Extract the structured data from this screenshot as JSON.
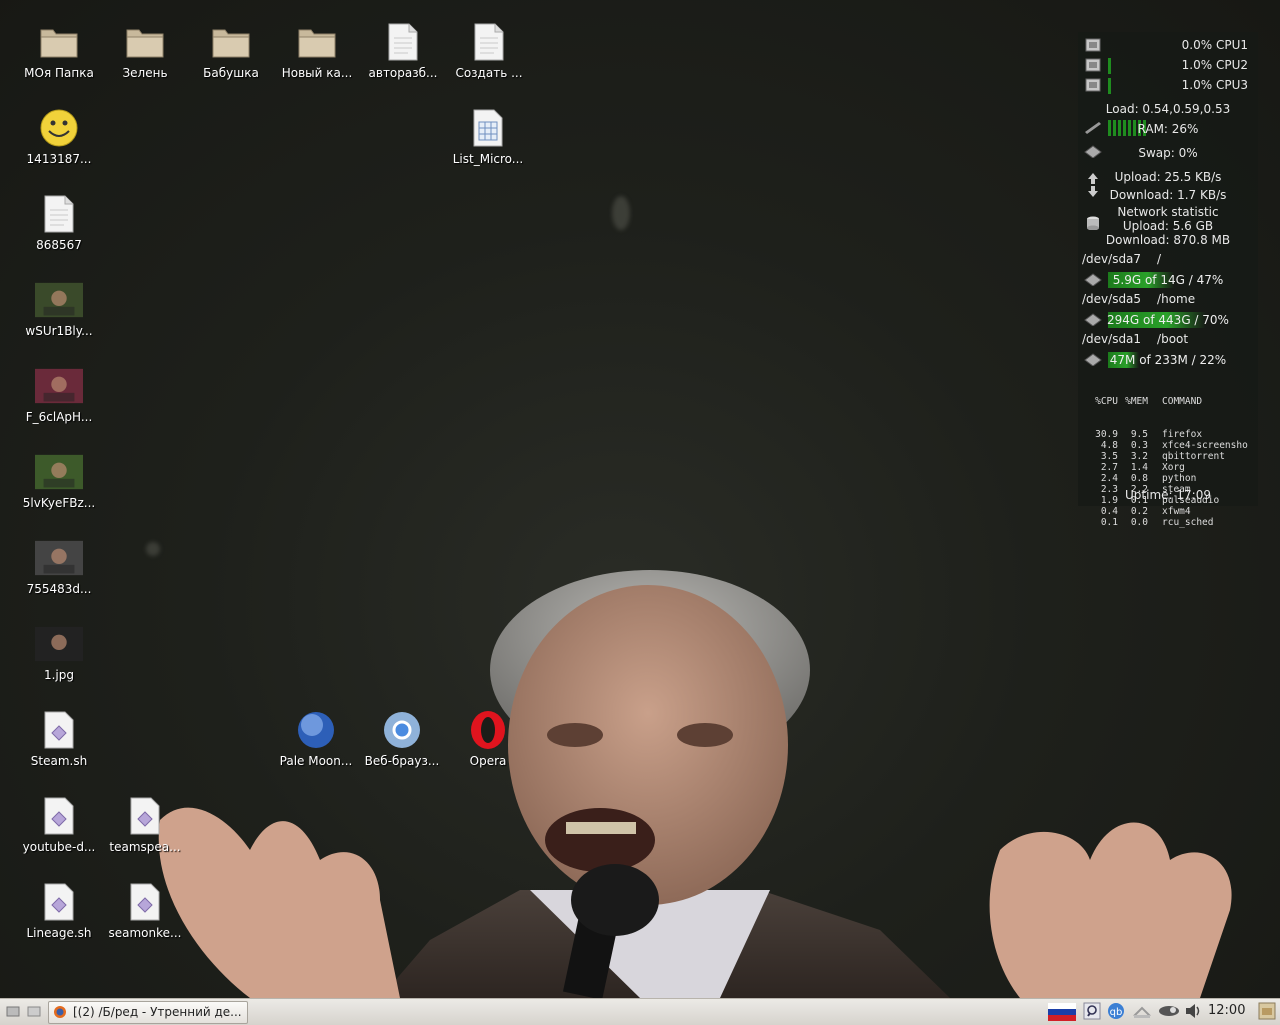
{
  "desktop": {
    "icons_row1": [
      {
        "label": "МОя Папка",
        "icon": "folder-icon"
      },
      {
        "label": "Зелень",
        "icon": "folder-icon"
      },
      {
        "label": "Бабушка",
        "icon": "folder-icon"
      },
      {
        "label": "Новый ка...",
        "icon": "folder-icon"
      },
      {
        "label": "авторазб...",
        "icon": "text-file-icon"
      },
      {
        "label": "Создать ...",
        "icon": "text-file-icon"
      }
    ],
    "list_micro": {
      "label": "List_Micro...",
      "icon": "spreadsheet-file-icon"
    },
    "column1": [
      {
        "label": "1413187...",
        "icon": "smiley-image-icon"
      },
      {
        "label": "868567",
        "icon": "text-file-icon"
      },
      {
        "label": "wSUr1Bly...",
        "icon": "image-thumbnail-icon"
      },
      {
        "label": "F_6clApH...",
        "icon": "image-thumbnail-icon"
      },
      {
        "label": "5lvKyeFBz...",
        "icon": "image-thumbnail-icon"
      },
      {
        "label": "755483d...",
        "icon": "image-thumbnail-icon"
      },
      {
        "label": "1.jpg",
        "icon": "image-thumbnail-icon"
      },
      {
        "label": "Steam.sh",
        "icon": "script-file-icon"
      },
      {
        "label": "youtube-d...",
        "icon": "script-file-icon"
      },
      {
        "label": "Lineage.sh",
        "icon": "script-file-icon"
      }
    ],
    "column2": [
      {
        "label": "teamspea...",
        "icon": "script-file-icon"
      },
      {
        "label": "seamonke...",
        "icon": "script-file-icon"
      }
    ],
    "browsers": [
      {
        "label": "Pale Moon...",
        "icon": "pale-moon-icon"
      },
      {
        "label": "Веб-брауз...",
        "icon": "chromium-icon"
      },
      {
        "label": "Opera",
        "icon": "opera-icon"
      }
    ]
  },
  "conky": {
    "cpu": [
      "0.0% CPU1",
      "1.0% CPU2",
      "1.0% CPU3"
    ],
    "load": "Load: 0.54,0.59,0.53",
    "ram": "RAM: 26%",
    "ram_fraction": 0.26,
    "swap": "Swap: 0%",
    "upload": "Upload: 25.5 KB/s",
    "download": "Download: 1.7 KB/s",
    "net_title": "Network statistic",
    "net_upload": "Upload: 5.6 GB",
    "net_download": "Download: 870.8 MB",
    "disks": [
      {
        "dev": "/dev/sda7",
        "mount": "/",
        "usage": "5.9G of 14G / 47%",
        "fraction": 0.47
      },
      {
        "dev": "/dev/sda5",
        "mount": "/home",
        "usage": "294G of 443G / 70%",
        "fraction": 0.7
      },
      {
        "dev": "/dev/sda1",
        "mount": "/boot",
        "usage": "47M of 233M / 22%",
        "fraction": 0.22
      }
    ],
    "proc_header": [
      "%CPU",
      "%MEM",
      "COMMAND"
    ],
    "processes": [
      [
        "30.9",
        "9.5",
        "firefox"
      ],
      [
        "4.8",
        "0.3",
        "xfce4-screensho"
      ],
      [
        "3.5",
        "3.2",
        "qbittorrent"
      ],
      [
        "2.7",
        "1.4",
        "Xorg"
      ],
      [
        "2.4",
        "0.8",
        "python"
      ],
      [
        "2.3",
        "2.2",
        "steam"
      ],
      [
        "1.9",
        "0.1",
        "pulseaudio"
      ],
      [
        "0.4",
        "0.2",
        "xfwm4"
      ],
      [
        "0.1",
        "0.0",
        "rcu_sched"
      ]
    ],
    "uptime": "Uptime: 17:09"
  },
  "taskbar": {
    "task_label": "[(2) /Б/ред - Утренний де...",
    "clock": "12:00",
    "tray": [
      "russia-flag-icon",
      "search-icon",
      "qbittorrent-icon",
      "network-icon",
      "steam-icon",
      "volume-icon"
    ]
  }
}
